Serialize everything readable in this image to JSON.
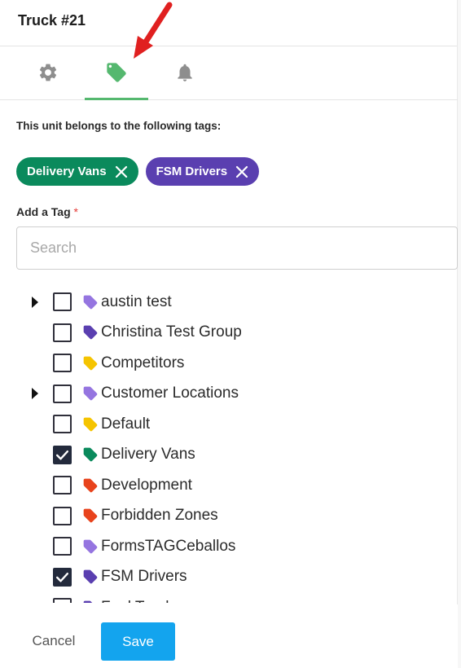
{
  "header": {
    "title": "Truck #21"
  },
  "tabs": [
    {
      "icon": "gear-icon",
      "active": false
    },
    {
      "icon": "tag-icon",
      "active": true
    },
    {
      "icon": "bell-icon",
      "active": false
    }
  ],
  "tags_section": {
    "intro": "This unit belongs to the following tags:",
    "chips": [
      {
        "label": "Delivery Vans",
        "color": "#0a8a5c"
      },
      {
        "label": "FSM Drivers",
        "color": "#5a3fb0"
      }
    ]
  },
  "add_tag": {
    "label": "Add a Tag",
    "required_mark": "*",
    "search_placeholder": "Search"
  },
  "tag_tree": [
    {
      "label": "austin test",
      "color": "#9575e0",
      "checked": false,
      "expandable": true
    },
    {
      "label": "Christina Test Group",
      "color": "#5a3fb0",
      "checked": false,
      "expandable": false
    },
    {
      "label": "Competitors",
      "color": "#f5c400",
      "checked": false,
      "expandable": false
    },
    {
      "label": "Customer Locations",
      "color": "#9575e0",
      "checked": false,
      "expandable": true
    },
    {
      "label": "Default",
      "color": "#f5c400",
      "checked": false,
      "expandable": false
    },
    {
      "label": "Delivery Vans",
      "color": "#0a8a5c",
      "checked": true,
      "expandable": false
    },
    {
      "label": "Development",
      "color": "#e8431c",
      "checked": false,
      "expandable": false
    },
    {
      "label": "Forbidden Zones",
      "color": "#e8431c",
      "checked": false,
      "expandable": false
    },
    {
      "label": "FormsTAGCeballos",
      "color": "#9575e0",
      "checked": false,
      "expandable": false
    },
    {
      "label": "FSM Drivers",
      "color": "#5a3fb0",
      "checked": true,
      "expandable": false
    },
    {
      "label": "Fuel Tracks",
      "color": "#5a3fb0",
      "checked": false,
      "expandable": false
    }
  ],
  "footer": {
    "cancel_label": "Cancel",
    "save_label": "Save"
  },
  "colors": {
    "accent_green": "#55b86f",
    "save_blue": "#13a4ee",
    "arrow_red": "#e02020"
  }
}
